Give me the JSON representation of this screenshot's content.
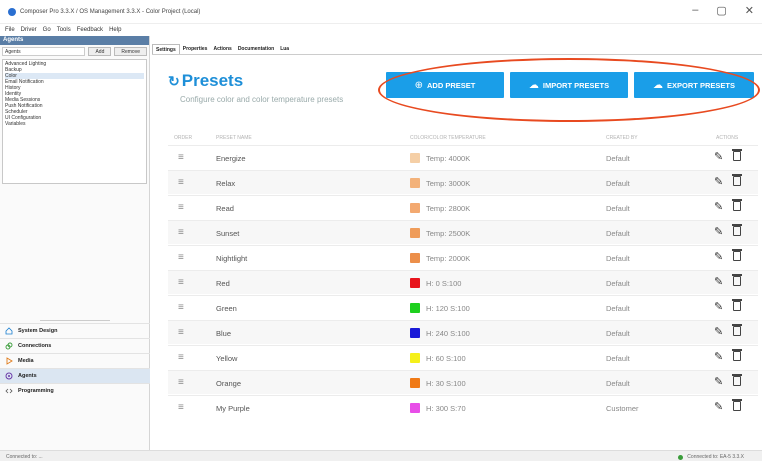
{
  "window": {
    "title": "Composer Pro 3.3.X / OS Management 3.3.X - Color Project (Local)",
    "controls": [
      "–",
      "▢",
      "✕"
    ]
  },
  "menubar": [
    "File",
    "Driver",
    "Go",
    "Tools",
    "Feedback",
    "Help"
  ],
  "left_panel": {
    "header": "Agents",
    "search_label": "Agents",
    "add_label": "Add",
    "remove_label": "Remove",
    "agents": [
      "Advanced Lighting",
      "Backup",
      "Color",
      "Email Notification",
      "History",
      "Identity",
      "Media Sessions",
      "Push Notification",
      "Scheduler",
      "UI Configuration",
      "Variables"
    ],
    "selected_agent": 2,
    "nav": [
      {
        "label": "System Design",
        "icon": "house-icon"
      },
      {
        "label": "Connections",
        "icon": "link-icon"
      },
      {
        "label": "Media",
        "icon": "play-icon"
      },
      {
        "label": "Agents",
        "icon": "agents-icon"
      },
      {
        "label": "Programming",
        "icon": "code-icon"
      }
    ],
    "active_nav": 3
  },
  "tabs": [
    "Settings",
    "Properties",
    "Actions",
    "Documentation",
    "Lua"
  ],
  "main": {
    "title": "Presets",
    "subtitle": "Configure color and color temperature presets",
    "buttons": {
      "add": "ADD PRESET",
      "import": "IMPORT PRESETS",
      "export": "EXPORT PRESETS"
    },
    "accent_color": "#1a9ee8",
    "highlight_color": "#e84a20",
    "columns": [
      "ORDER",
      "PRESET NAME",
      "COLOR/COLOR TEMPERATURE",
      "CREATED BY",
      "ACTIONS"
    ],
    "rows": [
      {
        "name": "Energize",
        "swatch": "#f5cfa6",
        "value": "Temp: 4000K",
        "creator": "Default"
      },
      {
        "name": "Relax",
        "swatch": "#f3b27a",
        "value": "Temp: 3000K",
        "creator": "Default"
      },
      {
        "name": "Read",
        "swatch": "#f3a970",
        "value": "Temp: 2800K",
        "creator": "Default"
      },
      {
        "name": "Sunset",
        "swatch": "#ef9c5a",
        "value": "Temp: 2500K",
        "creator": "Default"
      },
      {
        "name": "Nightlight",
        "swatch": "#ec8f4a",
        "value": "Temp: 2000K",
        "creator": "Default"
      },
      {
        "name": "Red",
        "swatch": "#e8141c",
        "value": "H: 0 S:100",
        "creator": "Default"
      },
      {
        "name": "Green",
        "swatch": "#1ed01e",
        "value": "H: 120 S:100",
        "creator": "Default"
      },
      {
        "name": "Blue",
        "swatch": "#1a1ad8",
        "value": "H: 240 S:100",
        "creator": "Default"
      },
      {
        "name": "Yellow",
        "swatch": "#f5f01a",
        "value": "H: 60 S:100",
        "creator": "Default"
      },
      {
        "name": "Orange",
        "swatch": "#f07a16",
        "value": "H: 30 S:100",
        "creator": "Default"
      },
      {
        "name": "My Purple",
        "swatch": "#e84ee8",
        "value": "H: 300 S:70",
        "creator": "Customer"
      }
    ]
  },
  "statusbar": {
    "left": "Connected to: ...",
    "right": "Connected to: EA-5 3.3.X"
  }
}
